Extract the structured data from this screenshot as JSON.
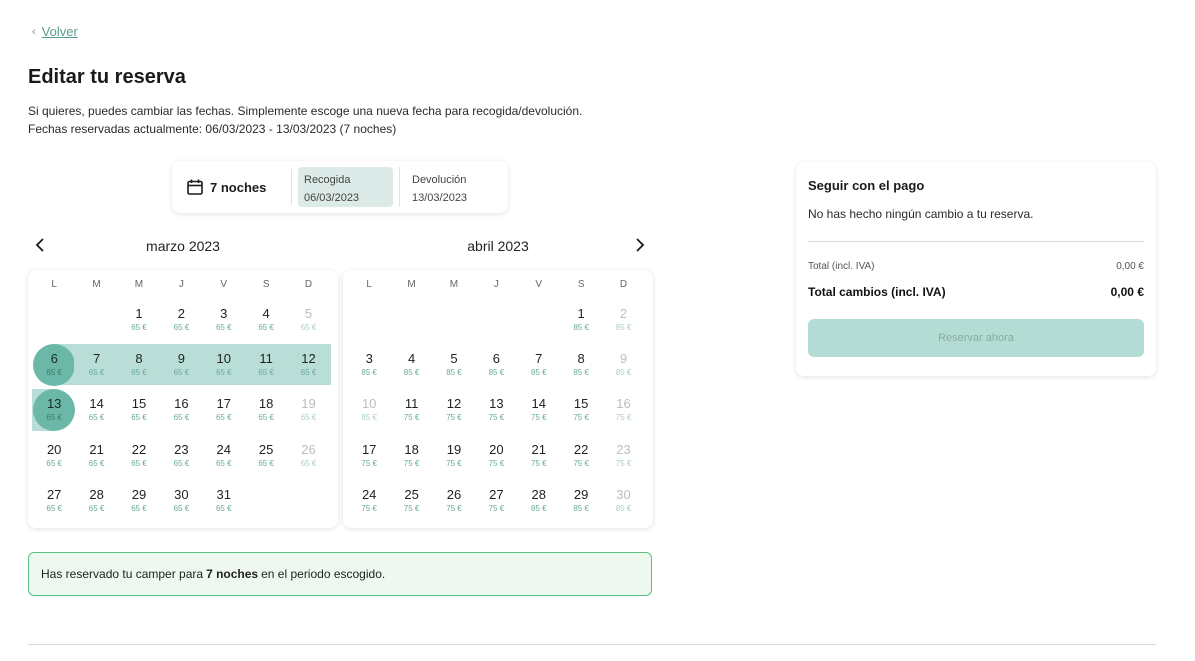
{
  "back": {
    "label": "Volver"
  },
  "title": "Editar tu reserva",
  "intro": {
    "line1": "Si quieres, puedes cambiar las fechas. Simplemente escoge una nueva fecha para recogida/devolución.",
    "line2": "Fechas reservadas actualmente: 06/03/2023 - 13/03/2023 (7 noches)"
  },
  "summary": {
    "nights": "7 noches",
    "pickup_label": "Recogida",
    "pickup_date": "06/03/2023",
    "return_label": "Devolución",
    "return_date": "13/03/2023"
  },
  "weekdays": [
    "L",
    "M",
    "M",
    "J",
    "V",
    "S",
    "D"
  ],
  "months": [
    {
      "title": "marzo 2023",
      "offset": 2,
      "days": [
        {
          "d": "1",
          "p": "65 €"
        },
        {
          "d": "2",
          "p": "65 €"
        },
        {
          "d": "3",
          "p": "65 €"
        },
        {
          "d": "4",
          "p": "65 €"
        },
        {
          "d": "5",
          "p": "65 €",
          "dis": true
        },
        {
          "d": "6",
          "p": "65 €",
          "sel": true,
          "start": true
        },
        {
          "d": "7",
          "p": "65 €",
          "range": true
        },
        {
          "d": "8",
          "p": "65 €",
          "range": true
        },
        {
          "d": "9",
          "p": "65 €",
          "range": true
        },
        {
          "d": "10",
          "p": "65 €",
          "range": true
        },
        {
          "d": "11",
          "p": "65 €",
          "range": true
        },
        {
          "d": "12",
          "p": "65 €",
          "range": true
        },
        {
          "d": "13",
          "p": "65 €",
          "sel": true,
          "end": true
        },
        {
          "d": "14",
          "p": "65 €"
        },
        {
          "d": "15",
          "p": "65 €"
        },
        {
          "d": "16",
          "p": "65 €"
        },
        {
          "d": "17",
          "p": "65 €"
        },
        {
          "d": "18",
          "p": "65 €"
        },
        {
          "d": "19",
          "p": "65 €",
          "dis": true
        },
        {
          "d": "20",
          "p": "65 €"
        },
        {
          "d": "21",
          "p": "65 €"
        },
        {
          "d": "22",
          "p": "65 €"
        },
        {
          "d": "23",
          "p": "65 €"
        },
        {
          "d": "24",
          "p": "65 €"
        },
        {
          "d": "25",
          "p": "65 €"
        },
        {
          "d": "26",
          "p": "65 €",
          "dis": true
        },
        {
          "d": "27",
          "p": "65 €"
        },
        {
          "d": "28",
          "p": "65 €"
        },
        {
          "d": "29",
          "p": "65 €"
        },
        {
          "d": "30",
          "p": "65 €"
        },
        {
          "d": "31",
          "p": "65 €"
        }
      ]
    },
    {
      "title": "abril 2023",
      "offset": 5,
      "days": [
        {
          "d": "1",
          "p": "85 €"
        },
        {
          "d": "2",
          "p": "85 €",
          "dis": true
        },
        {
          "d": "3",
          "p": "85 €"
        },
        {
          "d": "4",
          "p": "85 €"
        },
        {
          "d": "5",
          "p": "85 €"
        },
        {
          "d": "6",
          "p": "85 €"
        },
        {
          "d": "7",
          "p": "85 €"
        },
        {
          "d": "8",
          "p": "85 €"
        },
        {
          "d": "9",
          "p": "85 €",
          "dis": true
        },
        {
          "d": "10",
          "p": "85 €",
          "dis": true
        },
        {
          "d": "11",
          "p": "75 €"
        },
        {
          "d": "12",
          "p": "75 €"
        },
        {
          "d": "13",
          "p": "75 €"
        },
        {
          "d": "14",
          "p": "75 €"
        },
        {
          "d": "15",
          "p": "75 €"
        },
        {
          "d": "16",
          "p": "75 €",
          "dis": true
        },
        {
          "d": "17",
          "p": "75 €"
        },
        {
          "d": "18",
          "p": "75 €"
        },
        {
          "d": "19",
          "p": "75 €"
        },
        {
          "d": "20",
          "p": "75 €"
        },
        {
          "d": "21",
          "p": "75 €"
        },
        {
          "d": "22",
          "p": "75 €"
        },
        {
          "d": "23",
          "p": "75 €",
          "dis": true
        },
        {
          "d": "24",
          "p": "75 €"
        },
        {
          "d": "25",
          "p": "75 €"
        },
        {
          "d": "26",
          "p": "75 €"
        },
        {
          "d": "27",
          "p": "75 €"
        },
        {
          "d": "28",
          "p": "85 €"
        },
        {
          "d": "29",
          "p": "85 €"
        },
        {
          "d": "30",
          "p": "85 €",
          "dis": true
        }
      ]
    }
  ],
  "info": {
    "before": "Has reservado tu camper para",
    "bold": "7 noches",
    "after": "en el periodo escogido."
  },
  "payment": {
    "title": "Seguir con el pago",
    "message": "No has hecho ningún cambio a tu reserva.",
    "subtotal_label": "Total (incl. IVA)",
    "subtotal_value": "0,00 €",
    "total_label": "Total cambios (incl. IVA)",
    "total_value": "0,00 €",
    "button": "Reservar ahora"
  },
  "colors": {
    "accent": "#6bb8a8",
    "range": "#b9ded7",
    "price": "#6aaa9c",
    "success_border": "#59c27f"
  },
  "icons": {
    "back": "chevron-left-icon",
    "calendar": "calendar-icon",
    "prev": "chevron-left-icon",
    "next": "chevron-right-icon"
  }
}
